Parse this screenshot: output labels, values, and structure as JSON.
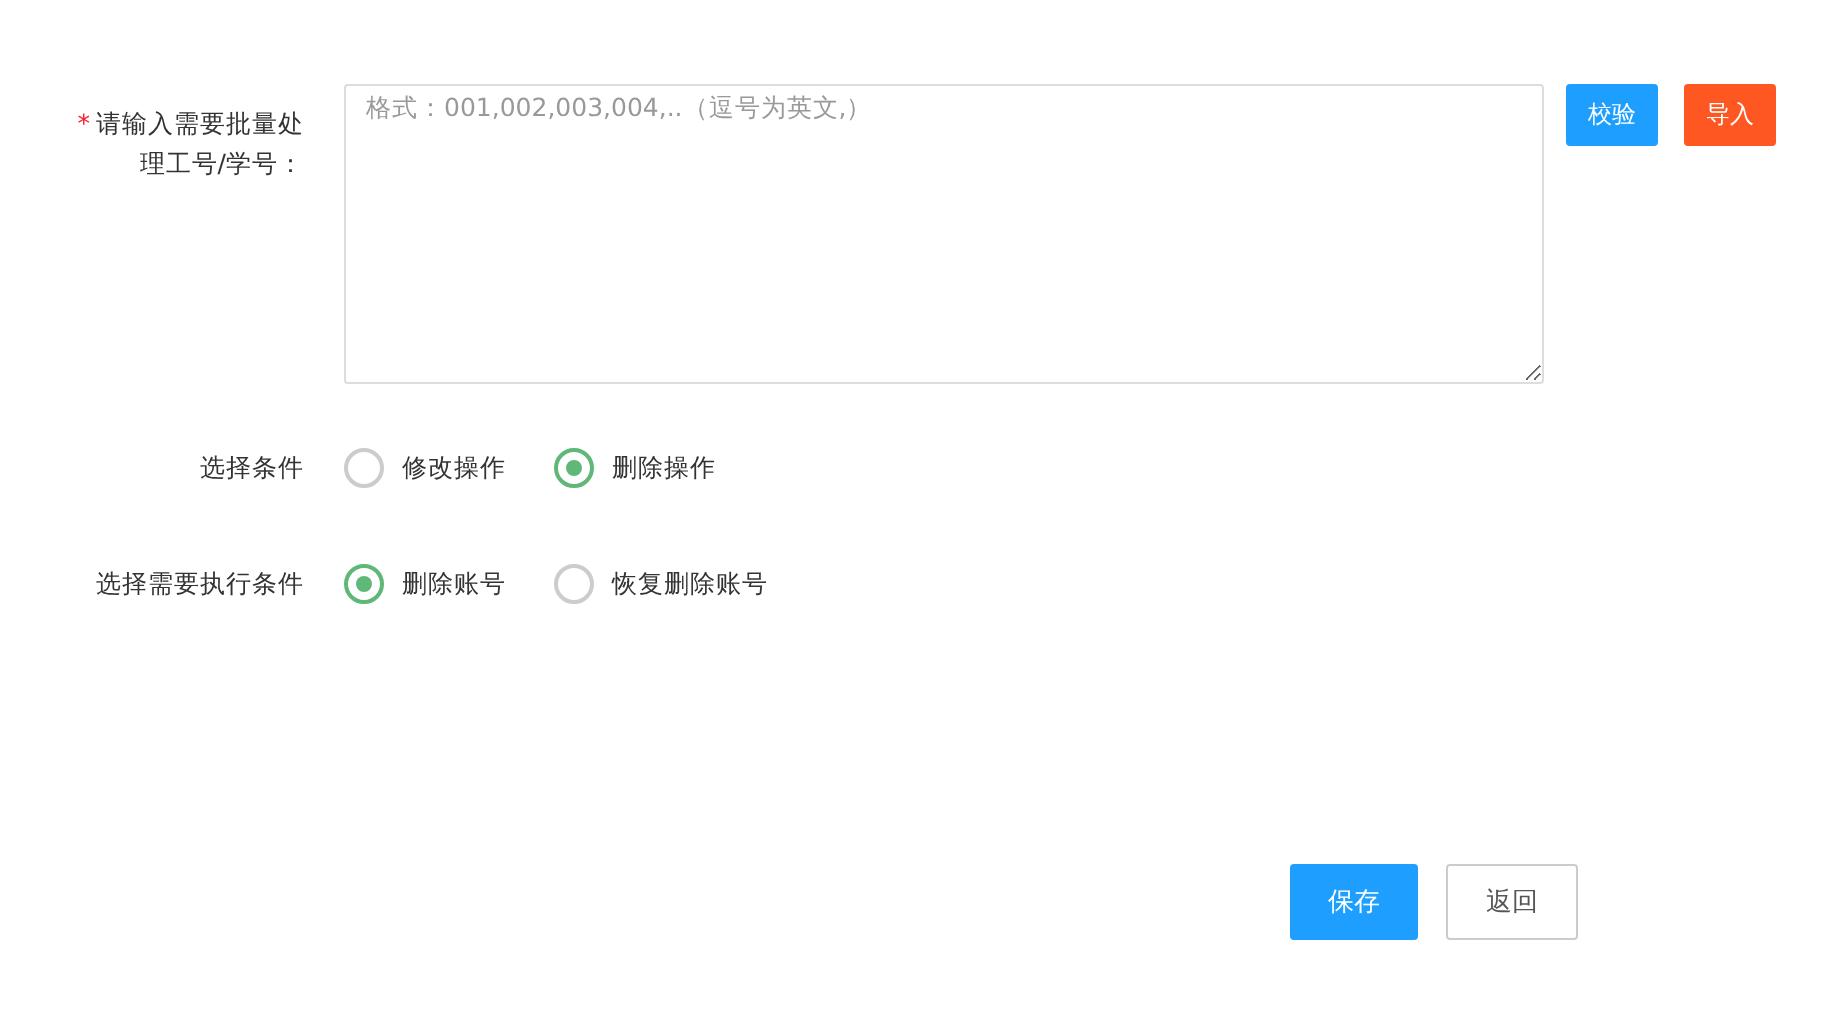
{
  "ids_field": {
    "required_mark": "*",
    "label": "请输入需要批量处理工号/学号：",
    "placeholder": "格式：001,002,003,004,..（逗号为英文,）"
  },
  "side_buttons": [
    {
      "label": "校验",
      "kind": "primary"
    },
    {
      "label": "导入",
      "kind": "warning"
    }
  ],
  "radio_groups": [
    {
      "label": "选择条件",
      "options": [
        {
          "label": "修改操作",
          "selected": false
        },
        {
          "label": "删除操作",
          "selected": true
        }
      ]
    },
    {
      "label": "选择需要执行条件",
      "options": [
        {
          "label": "删除账号",
          "selected": true
        },
        {
          "label": "恢复删除账号",
          "selected": false
        }
      ]
    }
  ],
  "footer_buttons": [
    {
      "label": "保存",
      "kind": "primary"
    },
    {
      "label": "返回",
      "kind": "default"
    }
  ]
}
